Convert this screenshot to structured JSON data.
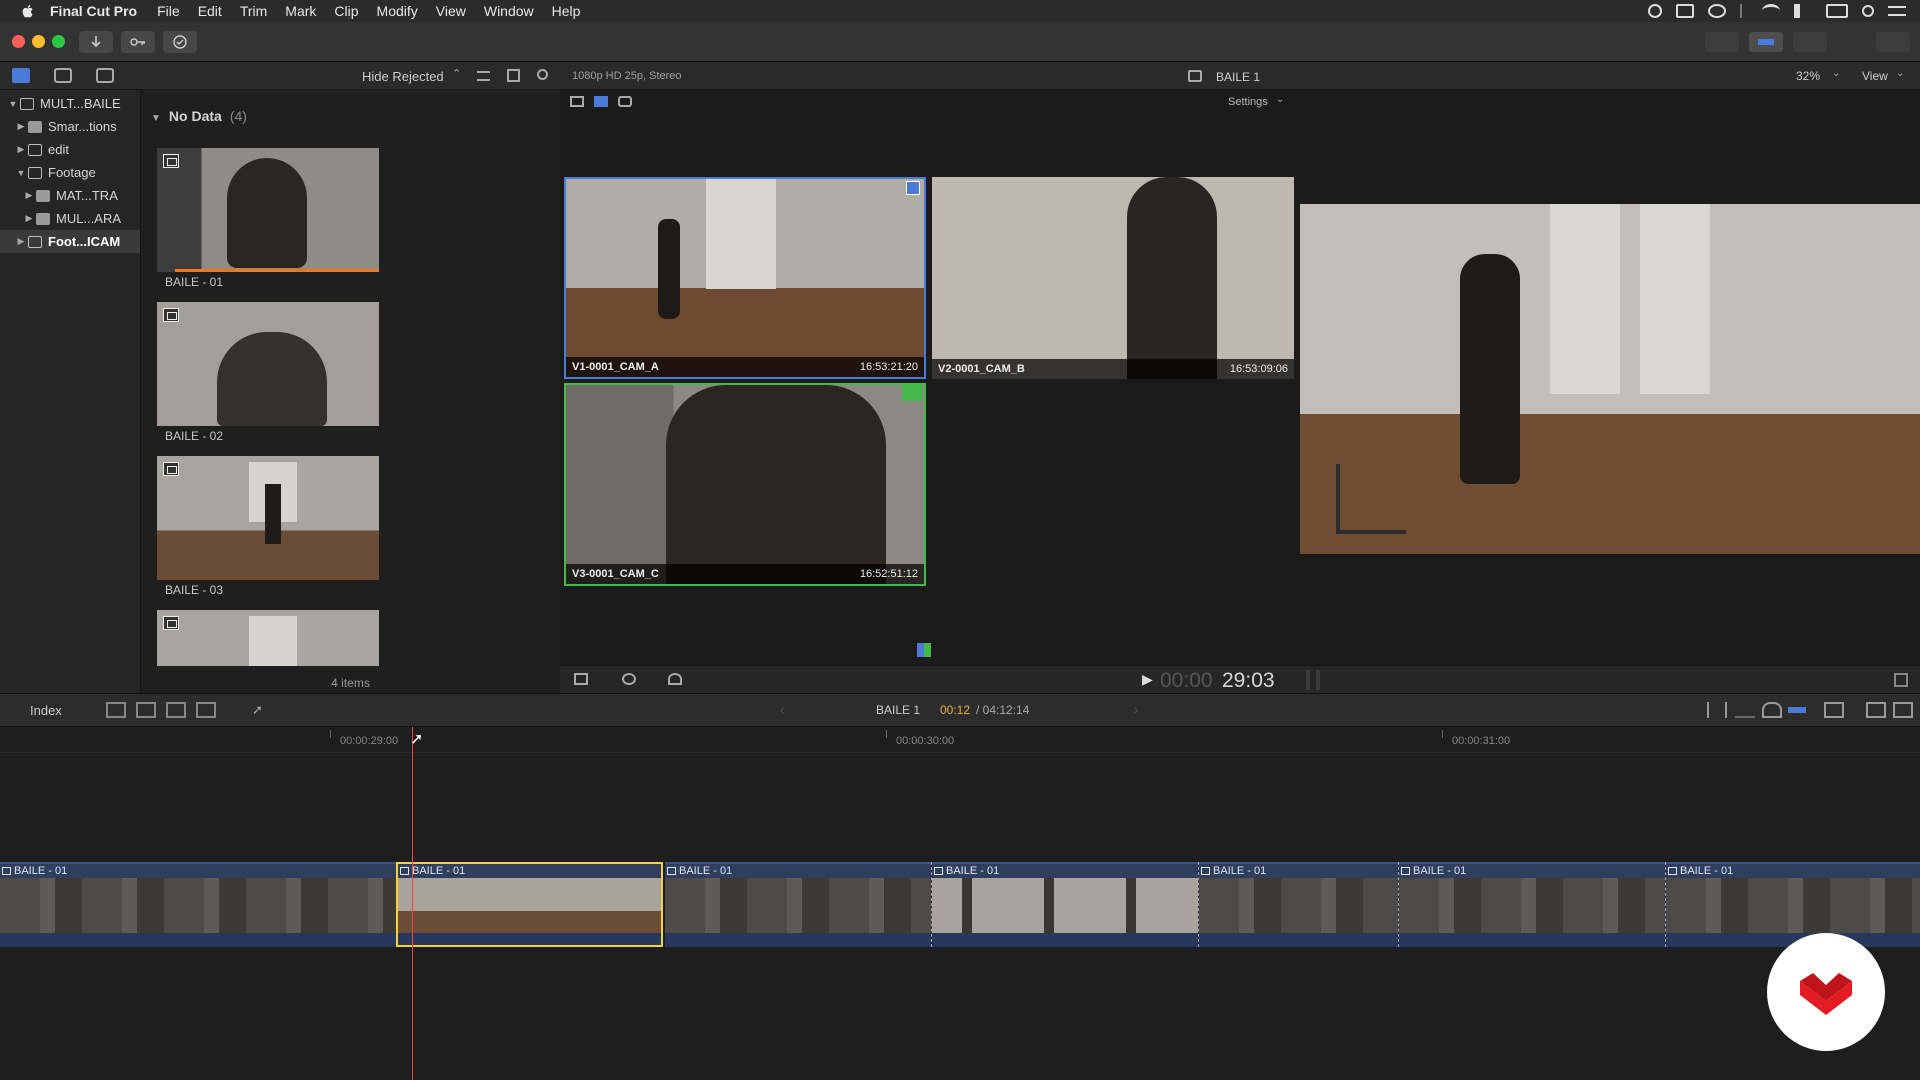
{
  "menubar": {
    "app_name": "Final Cut Pro",
    "items": [
      "File",
      "Edit",
      "Trim",
      "Mark",
      "Clip",
      "Modify",
      "View",
      "Window",
      "Help"
    ]
  },
  "library": {
    "filter_label": "Hide Rejected",
    "items": [
      {
        "label": "MULT...BAILE",
        "expanded": true
      },
      {
        "label": "Smar...tions",
        "expanded": false
      },
      {
        "label": "edit",
        "expanded": false
      },
      {
        "label": "Footage",
        "expanded": true
      },
      {
        "label": "MAT...TRA",
        "expanded": false
      },
      {
        "label": "MUL...ARA",
        "expanded": false
      },
      {
        "label": "Foot...ICAM",
        "expanded": false,
        "selected": true
      }
    ]
  },
  "browser": {
    "group_title": "No Data",
    "group_count": "(4)",
    "clips": [
      "BAILE - 01",
      "BAILE - 02",
      "BAILE - 03"
    ],
    "items_count": "4 items"
  },
  "angle_viewer": {
    "format": "1080p HD 25p, Stereo",
    "settings_label": "Settings",
    "angles": [
      {
        "name": "V1-0001_CAM_A",
        "timecode": "16:53:21:20"
      },
      {
        "name": "V2-0001_CAM_B",
        "timecode": "16:53:09:06"
      },
      {
        "name": "V3-0001_CAM_C",
        "timecode": "16:52:51:12"
      }
    ]
  },
  "viewer": {
    "title": "BAILE 1",
    "zoom": "32%",
    "view_label": "View"
  },
  "transport": {
    "timecode_dim": "00:00",
    "timecode": "29:03"
  },
  "timeline_bar": {
    "index_label": "Index",
    "project_name": "BAILE 1",
    "current_time": "00:12",
    "duration": "/ 04:12:14"
  },
  "ruler": {
    "labels": [
      "00:00:29:00",
      "00:00:30:00",
      "00:00:31:00"
    ]
  },
  "timeline": {
    "clips": [
      "BAILE - 01",
      "BAILE - 01",
      "BAILE - 01",
      "BAILE - 01",
      "BAILE - 01",
      "BAILE - 01",
      "BAILE - 01"
    ]
  },
  "colors": {
    "accent_blue": "#4a7bd6",
    "audio_green": "#44b84a",
    "selection_yellow": "#f5d142",
    "playhead_red": "#ff4040",
    "current_time_orange": "#e8b23a"
  }
}
